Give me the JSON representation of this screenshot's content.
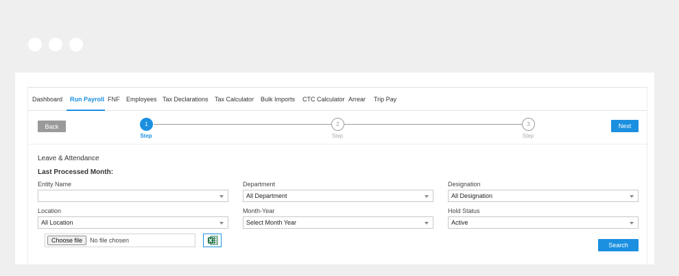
{
  "tabs": [
    {
      "label": "Dashboard"
    },
    {
      "label": "Run Payroll"
    },
    {
      "label": "FNF"
    },
    {
      "label": "Employees"
    },
    {
      "label": "Tax Declarations"
    },
    {
      "label": "Tax Calculator"
    },
    {
      "label": "Bulk Imports"
    },
    {
      "label": "CTC Calculator"
    },
    {
      "label": "Arrear"
    },
    {
      "label": "Trip Pay"
    }
  ],
  "active_tab": "Run Payroll",
  "buttons": {
    "back": "Back",
    "next": "Next",
    "search": "Search"
  },
  "stepper": {
    "steps": [
      {
        "number": "1",
        "label": "Step"
      },
      {
        "number": "2",
        "label": "Step"
      },
      {
        "number": "3",
        "label": "Step"
      }
    ],
    "current_step": 1
  },
  "section": {
    "title": "Leave & Attendance",
    "subtitle": "Last Processed Month:"
  },
  "fields": {
    "entity_name": {
      "label": "Entity Name",
      "value": ""
    },
    "department": {
      "label": "Department",
      "value": "All Department"
    },
    "designation": {
      "label": "Designation",
      "value": "All Designation"
    },
    "location": {
      "label": "Location",
      "value": "All Location"
    },
    "month_year": {
      "label": "Month-Year",
      "value": "Select Month Year"
    },
    "hold_status": {
      "label": "Hold Status",
      "value": "Active"
    }
  },
  "file_upload": {
    "button_label": "Choose file",
    "status": "No file chosen"
  },
  "icons": {
    "excel": "excel-icon",
    "dropdown": "chevron-down-icon"
  },
  "colors": {
    "accent": "#1b8fe0",
    "back_button": "#9a9a9a",
    "excel_green": "#1d7044"
  }
}
